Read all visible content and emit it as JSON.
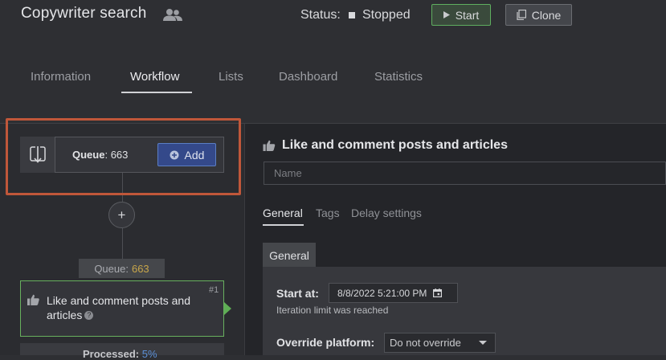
{
  "header": {
    "title": "Copywriter search",
    "status_label": "Status:",
    "status_value": "Stopped",
    "start_label": "Start",
    "clone_label": "Clone"
  },
  "tabs": [
    {
      "label": "Information",
      "active": false
    },
    {
      "label": "Workflow",
      "active": true
    },
    {
      "label": "Lists",
      "active": false
    },
    {
      "label": "Dashboard",
      "active": false
    },
    {
      "label": "Statistics",
      "active": false
    }
  ],
  "workflow": {
    "queue_label": "Queue",
    "queue_sep": ": ",
    "queue_count": "663",
    "add_label": "Add",
    "plus_symbol": "+",
    "pill_queue_label": "Queue:",
    "pill_queue_count": "663",
    "action_number": "#1",
    "action_title": "Like and comment posts and articles",
    "help_symbol": "?",
    "processed_label": "Processed:",
    "processed_value": "5%"
  },
  "detail": {
    "title": "Like and comment posts and articles",
    "name_placeholder": "Name",
    "name_value": "",
    "subtabs": [
      {
        "label": "General",
        "active": true
      },
      {
        "label": "Tags",
        "active": false
      },
      {
        "label": "Delay settings",
        "active": false
      }
    ],
    "section_tab": "General",
    "start_at_label": "Start at:",
    "start_at_value": "8/8/2022 5:21:00 PM",
    "iteration_message": "Iteration limit was reached",
    "override_label": "Override platform:",
    "override_value": "Do not override"
  },
  "icons": {
    "users": "users-icon",
    "play": "play-icon",
    "clone": "clone-icon",
    "queue_download": "download-icon",
    "add_plus": "plus-circle-icon",
    "thumb": "thumbs-up-icon",
    "calendar": "calendar-icon",
    "caret": "chevron-down-icon"
  },
  "colors": {
    "highlight": "#c0573a",
    "start_border": "#5fae5f",
    "add_button": "#34498a",
    "action_border": "#68b05e",
    "queue_count_pill": "#c8a64a",
    "processed_pct": "#5b8fd6"
  }
}
